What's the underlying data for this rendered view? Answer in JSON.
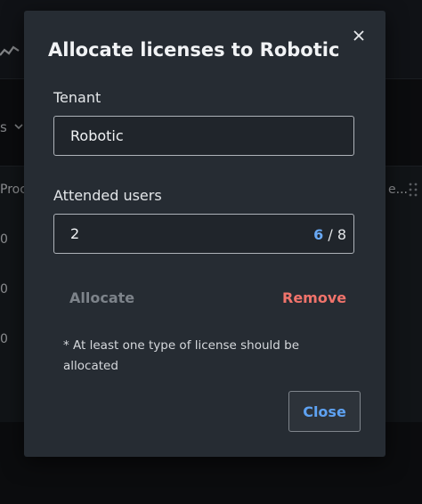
{
  "background": {
    "filter_label": "s",
    "column_left": "Proc",
    "column_right": "e...",
    "rows": [
      "0",
      "0",
      "0"
    ]
  },
  "dialog": {
    "title": "Allocate licenses to Robotic",
    "tenant_label": "Tenant",
    "tenant_value": "Robotic",
    "attended_label": "Attended users",
    "attended_value": "2",
    "used_count": "6",
    "counter_separator": " / ",
    "total_count": "8",
    "allocate_label": "Allocate",
    "remove_label": "Remove",
    "note": "* At least one type of license should be allocated",
    "close_label": "Close"
  },
  "colors": {
    "modal_bg": "#262c33",
    "accent": "#5ea2f2",
    "danger": "#f0736b",
    "disabled": "#7d838a"
  }
}
